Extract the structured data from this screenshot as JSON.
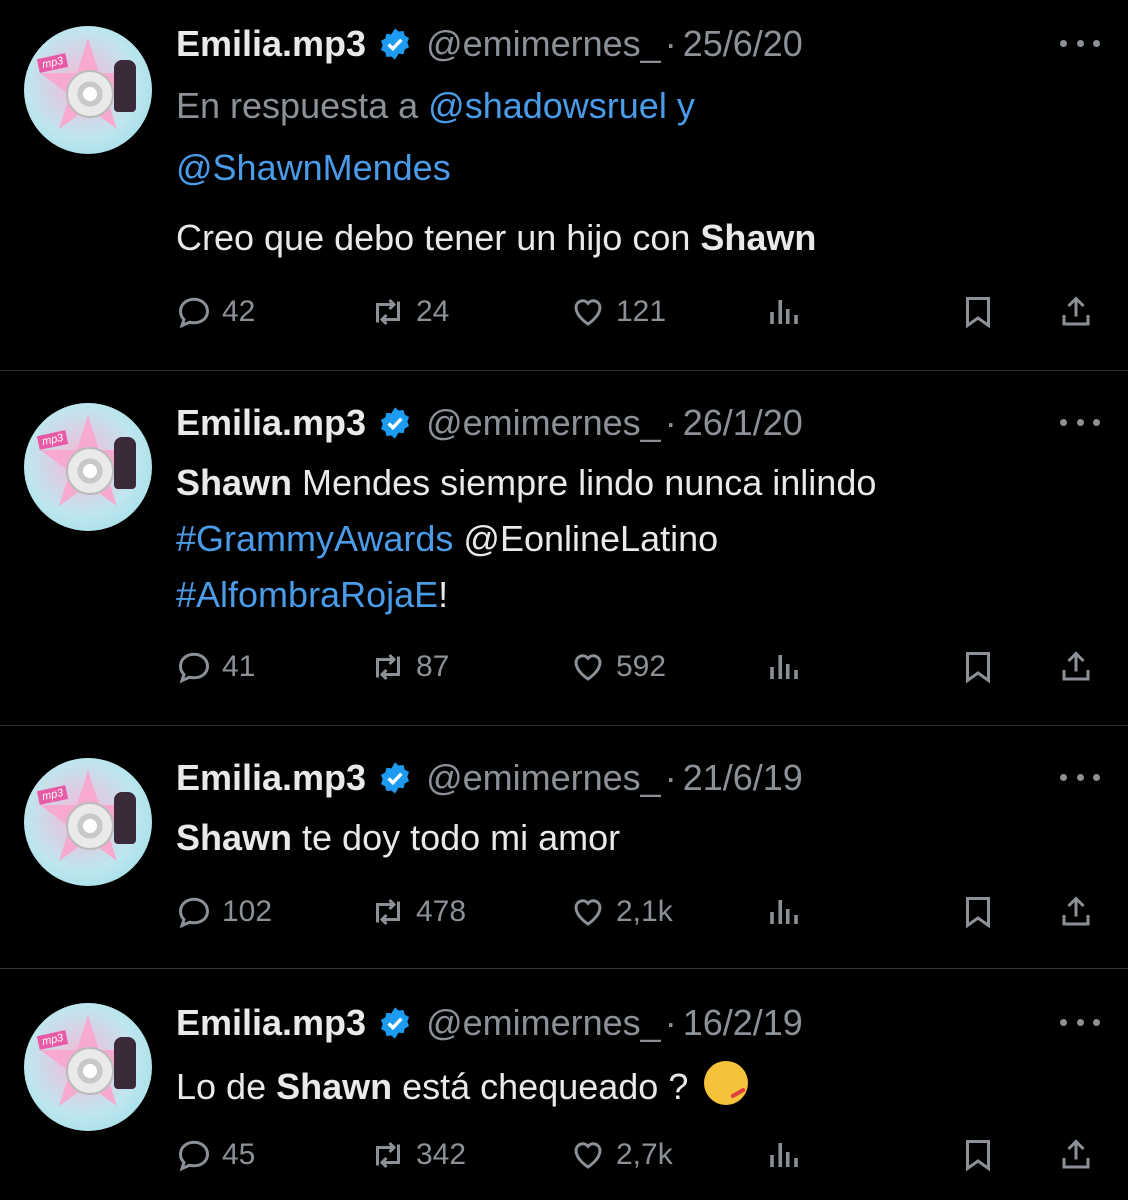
{
  "tweets": [
    {
      "name": "Emilia.mp3",
      "handle": "@emimernes_",
      "sep": "·",
      "date": "25/6/20",
      "reply_prefix": "En respuesta a ",
      "reply_to1": "@shadowsruel y",
      "reply_to2": "@ShawnMendes",
      "text_a": "Creo que debo tener un hijo con ",
      "text_b": "Shawn",
      "replies": "42",
      "retweets": "24",
      "likes": "121"
    },
    {
      "name": "Emilia.mp3",
      "handle": "@emimernes_",
      "sep": "·",
      "date": "26/1/20",
      "line1_bold": "Shawn",
      "line1_rest": " Mendes siempre lindo nunca inlindo",
      "line2_tag": "#GrammyAwards",
      "line2_rest": " @EonlineLatino",
      "line3_tag": "#AlfombraRojaE",
      "line3_rest": "!",
      "replies": "41",
      "retweets": "87",
      "likes": "592"
    },
    {
      "name": "Emilia.mp3",
      "handle": "@emimernes_",
      "sep": "·",
      "date": "21/6/19",
      "text_bold": "Shawn",
      "text_rest": " te doy todo mi amor",
      "replies": "102",
      "retweets": "478",
      "likes": "2,1k"
    },
    {
      "name": "Emilia.mp3",
      "handle": "@emimernes_",
      "sep": "·",
      "date": "16/2/19",
      "text_a": "Lo de ",
      "text_bold": "Shawn",
      "text_b": " está chequeado ? ",
      "emoji": "face-with-thermometer",
      "replies": "45",
      "retweets": "342",
      "likes": "2,7k"
    }
  ],
  "avatar_label": "mp3",
  "colors": {
    "background": "#000000",
    "link": "#4a9ce8",
    "muted": "#8b9197",
    "verified": "#1d9bf0"
  }
}
